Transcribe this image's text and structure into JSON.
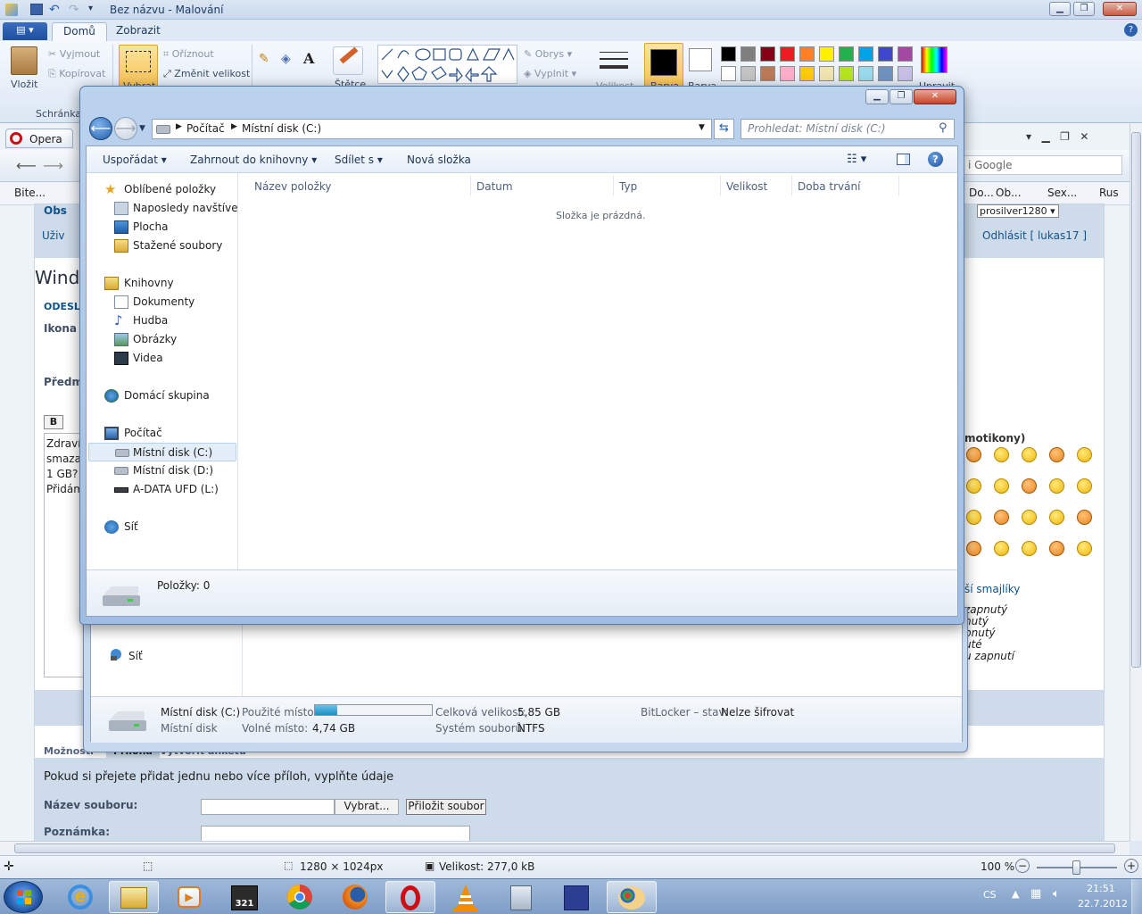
{
  "paint": {
    "title": "Bez názvu - Malování",
    "tabs": [
      "Domů",
      "Zobrazit"
    ],
    "groups": {
      "clipboard": {
        "paste": "Vložit",
        "cut": "Vyjmout",
        "copy": "Kopírovat",
        "label": "Schránka"
      },
      "image": {
        "select": "Vybrat",
        "crop": "Oříznout",
        "resize": "Změnit velikost"
      },
      "brushes": "Štětce",
      "shapes": {
        "outline": "Obrys",
        "fill": "Vyplnit"
      },
      "size": "Velikost",
      "color1": "Barva",
      "color2": "Barva",
      "edit_colors": "Upravit"
    },
    "palette_row1": [
      "#000000",
      "#7f7f7f",
      "#880015",
      "#ed1c24",
      "#ff7f27",
      "#fff200",
      "#22b14c",
      "#00a2e8",
      "#3f48cc",
      "#a349a4"
    ],
    "palette_row2": [
      "#ffffff",
      "#c3c3c3",
      "#b97a57",
      "#ffaec9",
      "#ffc90e",
      "#efe4b0",
      "#b5e61d",
      "#99d9ea",
      "#7092be",
      "#c8bfe7"
    ],
    "status": {
      "dimensions": "1280 × 1024px",
      "size": "Velikost: 277,0 kB",
      "zoom": "100 %"
    }
  },
  "browser": {
    "tab": "Opera",
    "search": "i Google",
    "bookmarks": [
      "Bite...",
      "Do...",
      "Ob...",
      "Sex...",
      "Rus"
    ],
    "forum": {
      "obs": "Obs",
      "user": "Uživ",
      "style": "prosilver1280",
      "logout": "Odhlásit [ lukas17 ]",
      "heading": "Windo",
      "odesla": "ODESLA",
      "ikona": "Ikona",
      "predmet": "Předm",
      "bold": "B",
      "text_lines": [
        "Zdraví",
        "smaza",
        "1 GB?",
        "Přidám"
      ],
      "smileys_title": "motikony)",
      "more_smileys": "ší smajlíky",
      "options": [
        "zapnutý",
        "nutý",
        "pnutý",
        "uté",
        "u zapnutí"
      ],
      "tabs": [
        "Možnosti",
        "Příloha",
        "Vytvořit anketu"
      ],
      "attach_hint": "Pokud si přejete přidat jednu nebo více příloh, vyplňte údaje",
      "filename_label": "Název souboru:",
      "browse": "Vybrat...",
      "attach_btn": "Přiložit soubor",
      "note_label": "Poznámka:"
    }
  },
  "back_explorer": {
    "nav_network": "Síť",
    "drive_name": "Místní disk (C:)",
    "drive_type": "Místní disk",
    "used_label": "Použité místo:",
    "used_fraction": 0.19,
    "free_label": "Volné místo:",
    "free_value": "4,74 GB",
    "total_label": "Celková velikost:",
    "total_value": "5,85 GB",
    "fs_label": "Systém souborů:",
    "fs_value": "NTFS",
    "bitlocker_label": "BitLocker – stav:",
    "bitlocker_value": "Nelze šifrovat"
  },
  "explorer": {
    "breadcrumb": [
      "Počítač",
      "Místní disk (C:)"
    ],
    "search_placeholder": "Prohledat: Místní disk (C:)",
    "commands": {
      "organize": "Uspořádat",
      "include": "Zahrnout do knihovny",
      "share": "Sdílet s",
      "new_folder": "Nová složka"
    },
    "nav": {
      "favorites": "Oblíbené položky",
      "recent": "Naposledy navštívené",
      "desktop": "Plocha",
      "downloads": "Stažené soubory",
      "libraries": "Knihovny",
      "documents": "Dokumenty",
      "music": "Hudba",
      "pictures": "Obrázky",
      "videos": "Videa",
      "homegroup": "Domácí skupina",
      "computer": "Počítač",
      "drive_c": "Místní disk (C:)",
      "drive_d": "Místní disk (D:)",
      "drive_l": "A-DATA UFD (L:)",
      "network": "Síť"
    },
    "columns": [
      "Název položky",
      "Datum",
      "Typ",
      "Velikost",
      "Doba trvání"
    ],
    "empty_message": "Složka je prázdná.",
    "item_count": "Položky: 0"
  },
  "taskbar": {
    "lang": "CS",
    "time": "21:51",
    "date": "22.7.2012"
  }
}
